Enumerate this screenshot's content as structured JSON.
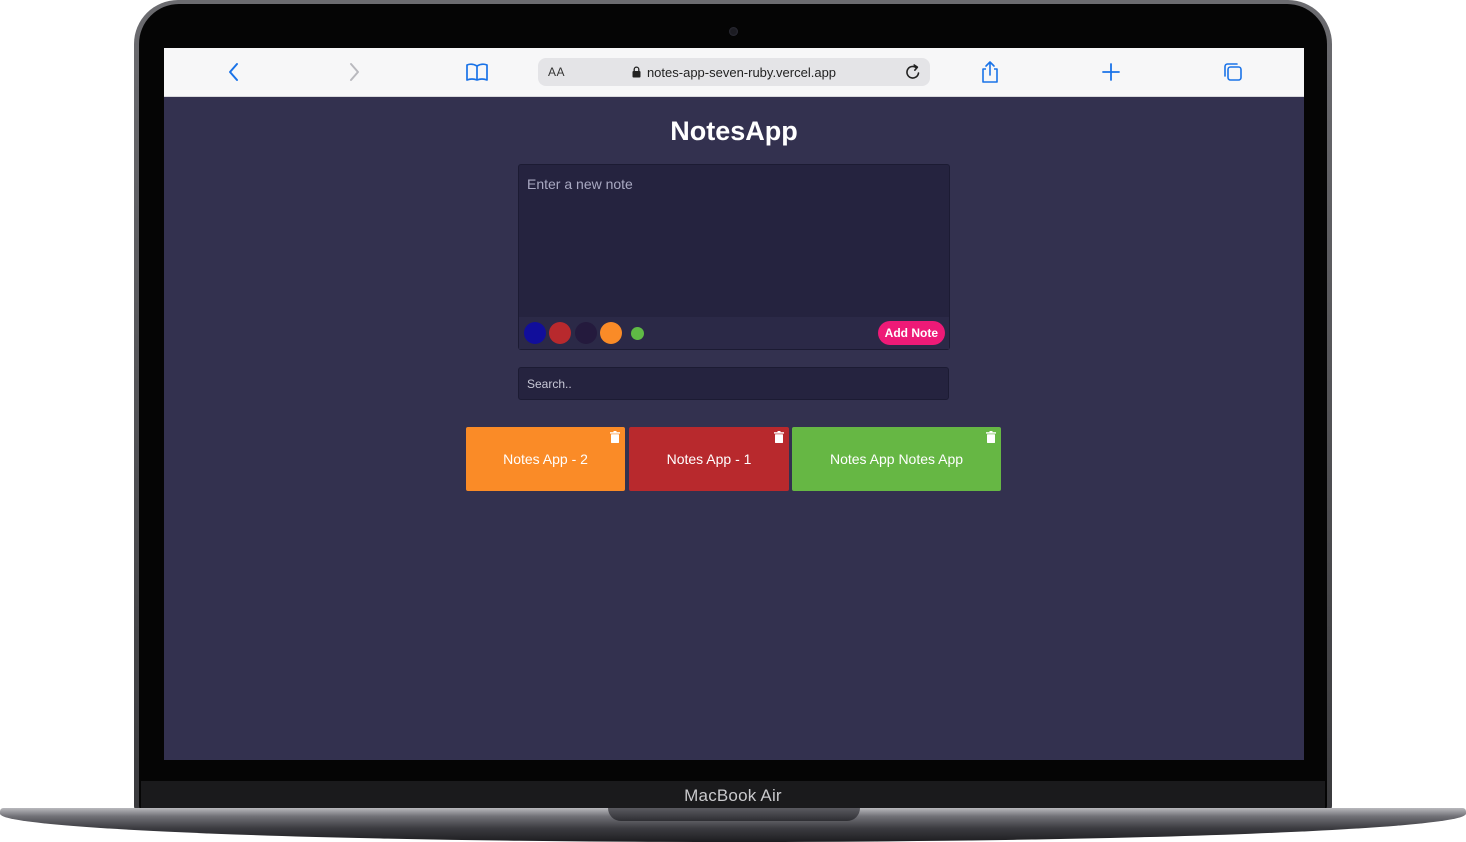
{
  "device": {
    "label": "MacBook Air"
  },
  "browser": {
    "address_prefix": "AA",
    "url": "notes-app-seven-ruby.vercel.app",
    "icons": {
      "back": "chevron-left-icon",
      "forward": "chevron-right-icon",
      "bookmarks": "book-icon",
      "lock": "lock-icon",
      "reload": "reload-icon",
      "share": "share-icon",
      "new_tab": "plus-icon",
      "tabs": "tabs-icon"
    },
    "accent_color": "#1a73e8"
  },
  "app": {
    "title": "NotesApp",
    "background_color": "#33314f",
    "composer": {
      "placeholder": "Enter a new note",
      "add_button_label": "Add Note",
      "add_button_color": "#ee1a77",
      "colors": [
        "#110e9b",
        "#b8292d",
        "#241a3d",
        "#fa8b27",
        "#5fba45"
      ]
    },
    "search": {
      "placeholder": "Search.."
    },
    "notes": [
      {
        "text": "Notes App - 2",
        "color": "#fa8b27"
      },
      {
        "text": "Notes App - 1",
        "color": "#b8292d"
      },
      {
        "text": "Notes App Notes App",
        "color": "#66b744"
      }
    ]
  }
}
